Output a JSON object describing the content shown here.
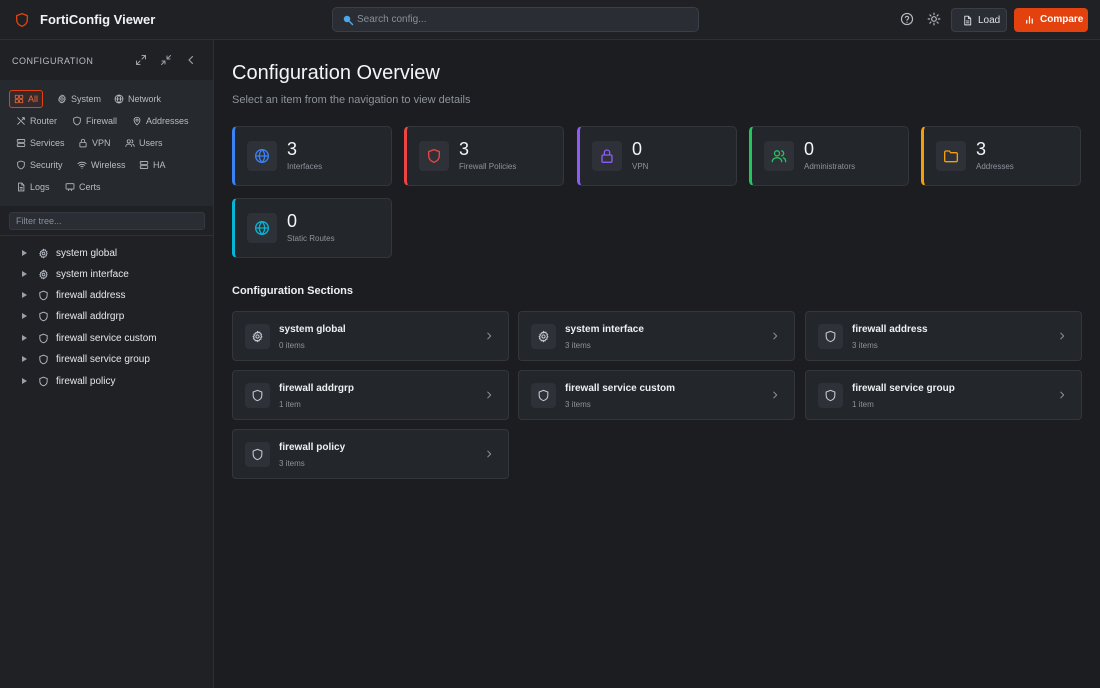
{
  "header": {
    "app_title": "FortiConfig Viewer",
    "search_placeholder": "Search config...",
    "load_label": "Load",
    "compare_label": "Compare",
    "accent_color": "#e3420f"
  },
  "sidebar": {
    "title": "CONFIGURATION",
    "filters": [
      {
        "label": "All",
        "icon": "grid-icon",
        "active": true
      },
      {
        "label": "System",
        "icon": "gear-icon"
      },
      {
        "label": "Network",
        "icon": "globe-icon"
      },
      {
        "label": "Router",
        "icon": "route-icon"
      },
      {
        "label": "Firewall",
        "icon": "shield-icon"
      },
      {
        "label": "Addresses",
        "icon": "map-pin-icon"
      },
      {
        "label": "Services",
        "icon": "server-icon"
      },
      {
        "label": "VPN",
        "icon": "lock-icon"
      },
      {
        "label": "Users",
        "icon": "users-icon"
      },
      {
        "label": "Security",
        "icon": "shield-icon"
      },
      {
        "label": "Wireless",
        "icon": "wifi-icon"
      },
      {
        "label": "HA",
        "icon": "server-icon"
      },
      {
        "label": "Logs",
        "icon": "file-icon"
      },
      {
        "label": "Certs",
        "icon": "certificate-icon"
      }
    ],
    "tree_filter_placeholder": "Filter tree...",
    "tree": [
      {
        "label": "system global",
        "icon": "gear-icon"
      },
      {
        "label": "system interface",
        "icon": "gear-icon"
      },
      {
        "label": "firewall address",
        "icon": "shield-icon"
      },
      {
        "label": "firewall addrgrp",
        "icon": "shield-icon"
      },
      {
        "label": "firewall service custom",
        "icon": "shield-icon"
      },
      {
        "label": "firewall service group",
        "icon": "shield-icon"
      },
      {
        "label": "firewall policy",
        "icon": "shield-icon"
      }
    ]
  },
  "main": {
    "title": "Configuration Overview",
    "subtitle": "Select an item from the navigation to view details",
    "stats": [
      {
        "value": "3",
        "label": "Interfaces",
        "icon": "globe-icon",
        "color": "#3b82f6"
      },
      {
        "value": "3",
        "label": "Firewall Policies",
        "icon": "shield-icon",
        "color": "#ef4444"
      },
      {
        "value": "0",
        "label": "VPN",
        "icon": "lock-icon",
        "color": "#8b5cf6"
      },
      {
        "value": "0",
        "label": "Administrators",
        "icon": "users-icon",
        "color": "#22c55e"
      },
      {
        "value": "3",
        "label": "Addresses",
        "icon": "folder-icon",
        "color": "#f59e0b"
      },
      {
        "value": "0",
        "label": "Static Routes",
        "icon": "globe-icon",
        "color": "#06b6d4"
      }
    ],
    "sections_heading": "Configuration Sections",
    "sections": [
      {
        "title": "system global",
        "count": "0 items",
        "icon": "gear-icon"
      },
      {
        "title": "system interface",
        "count": "3 items",
        "icon": "gear-icon"
      },
      {
        "title": "firewall address",
        "count": "3 items",
        "icon": "shield-icon"
      },
      {
        "title": "firewall addrgrp",
        "count": "1 item",
        "icon": "shield-icon"
      },
      {
        "title": "firewall service custom",
        "count": "3 items",
        "icon": "shield-icon"
      },
      {
        "title": "firewall service group",
        "count": "1 item",
        "icon": "shield-icon"
      },
      {
        "title": "firewall policy",
        "count": "3 items",
        "icon": "shield-icon"
      }
    ]
  }
}
